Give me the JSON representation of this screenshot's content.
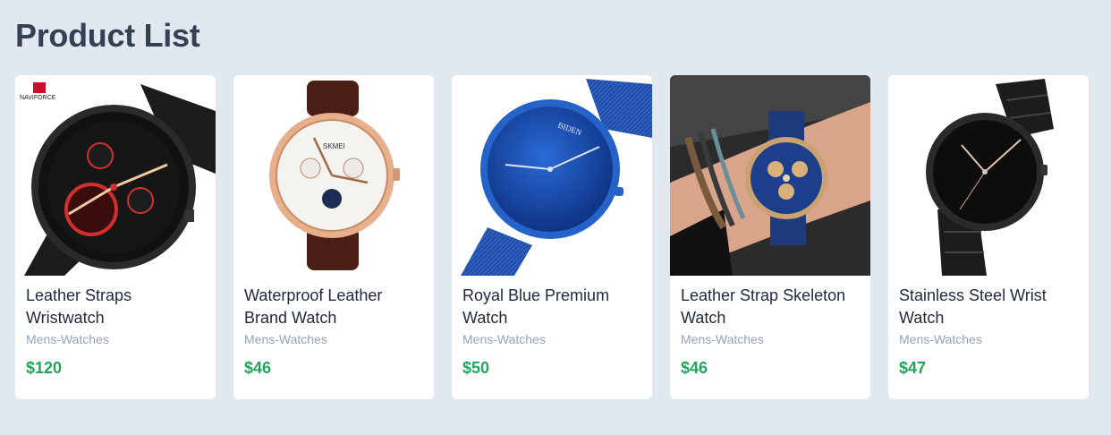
{
  "page": {
    "title": "Product List"
  },
  "products": [
    {
      "name": "Leather Straps Wristwatch",
      "category": "Mens-Watches",
      "price": "$120",
      "brand_mark": "NAVIFORCE"
    },
    {
      "name": "Waterproof Leather Brand Watch",
      "category": "Mens-Watches",
      "price": "$46",
      "brand_mark": "SKMEI"
    },
    {
      "name": "Royal Blue Premium Watch",
      "category": "Mens-Watches",
      "price": "$50",
      "brand_mark": "BIDEN"
    },
    {
      "name": "Leather Strap Skeleton Watch",
      "category": "Mens-Watches",
      "price": "$46"
    },
    {
      "name": "Stainless Steel Wrist Watch",
      "category": "Mens-Watches",
      "price": "$47"
    }
  ],
  "colors": {
    "background": "#e2e8f0",
    "title": "#334155",
    "price": "#22a55b",
    "category": "#94a3b8"
  }
}
